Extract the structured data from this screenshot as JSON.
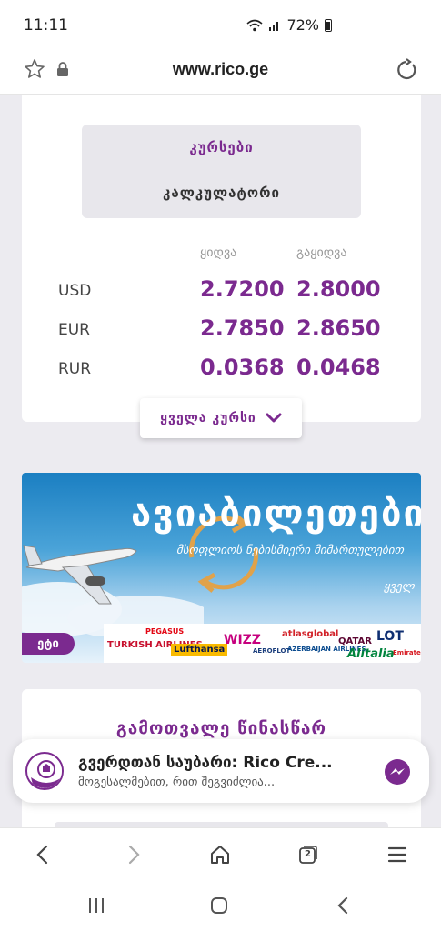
{
  "status": {
    "time": "11:11",
    "battery": "72%"
  },
  "browser": {
    "url": "www.rico.ge",
    "tab_count": "2"
  },
  "rates_card": {
    "tab_rates": "კურსები",
    "tab_calculator": "კალკულატორი",
    "col_buy": "ყიდვა",
    "col_sell": "გაყიდვა",
    "rows": [
      {
        "currency": "USD",
        "buy": "2.7200",
        "sell": "2.8000"
      },
      {
        "currency": "EUR",
        "buy": "2.7850",
        "sell": "2.8650"
      },
      {
        "currency": "RUR",
        "buy": "0.0368",
        "sell": "0.0468"
      }
    ],
    "all_rates_label": "ყველა კურსი"
  },
  "banner": {
    "title": "ავიაბილეთები",
    "subtitle": "მსოფლიოს ნებისმიერი მიმართულებით",
    "corner_text": "ყველ",
    "tag": "ეტი",
    "logos": [
      "TURKISH AIRLINES",
      "PEGASUS",
      "Lufthansa",
      "WIZZ",
      "AEROFLOT",
      "atlasglobal",
      "AZERBAIJAN AIRLINES",
      "QATAR",
      "Alitalia",
      "LOT",
      "Emirates"
    ]
  },
  "calc_card": {
    "title": "გამოთვალე წინასწარ"
  },
  "chat": {
    "title": "გვერდთან საუბარი: Rico Cre...",
    "subtitle": "მოგესალმებით, რით შეგვიძლია..."
  },
  "colors": {
    "accent": "#7b2a8f",
    "background": "#ecebf0",
    "messenger": "#7b2a8f"
  }
}
